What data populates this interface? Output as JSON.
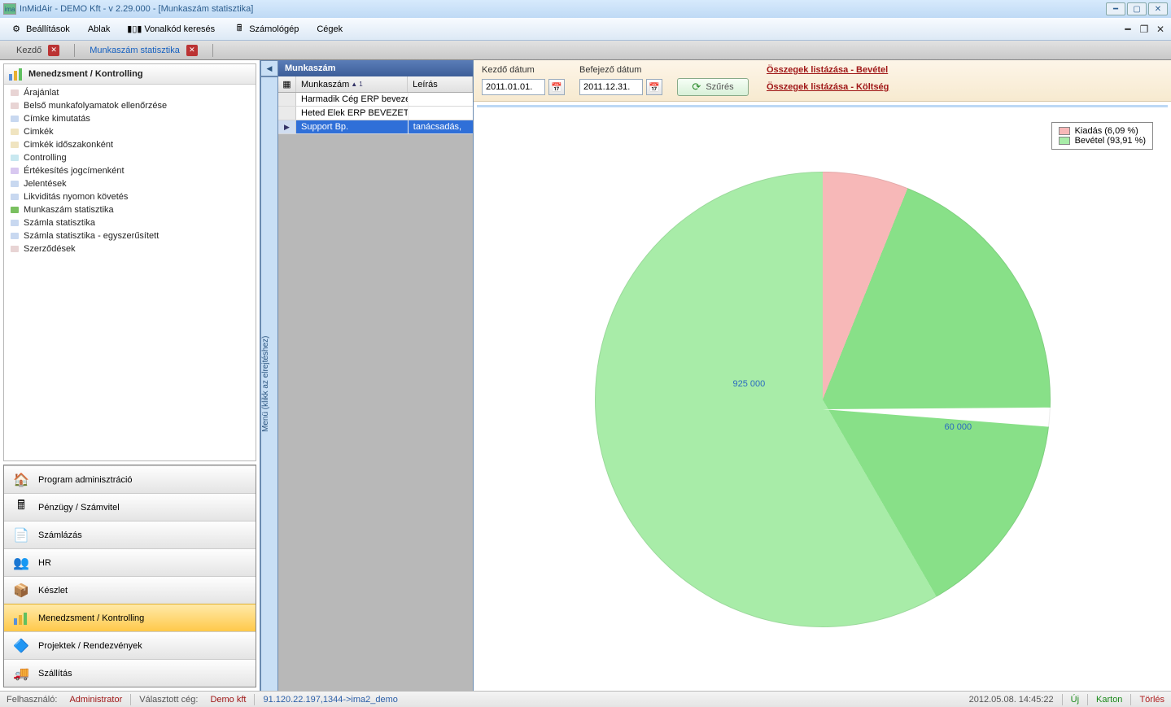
{
  "window": {
    "title": "InMidAir - DEMO Kft - v 2.29.000 - [Munkaszám statisztika]"
  },
  "menu": {
    "settings": "Beállítások",
    "window": "Ablak",
    "barcode_search": "Vonalkód keresés",
    "calculator": "Számológép",
    "companies": "Cégek"
  },
  "tabs": {
    "home": "Kezdő",
    "workno_stats": "Munkaszám statisztika"
  },
  "sidebar": {
    "header": "Menedzsment / Kontrolling",
    "items": [
      "Árajánlat",
      "Belső munkafolyamatok ellenőrzése",
      "Címke kimutatás",
      "Cimkék",
      "Cimkék időszakonként",
      "Controlling",
      "Értékesítés jogcímenként",
      "Jelentések",
      "Likviditás nyomon követés",
      "Munkaszám statisztika",
      "Számla statisztika",
      "Számla statisztika - egyszerűsített",
      "Szerződések"
    ],
    "bullet_colors": [
      "#e8d4d4",
      "#e8d4d4",
      "#c8d8f0",
      "#f0e4c0",
      "#f0e4c0",
      "#c8e8f0",
      "#d8c8f0",
      "#c8d8f0",
      "#c8d8f0",
      "#7ac060",
      "#c8d8f0",
      "#c8d8f0",
      "#e8d4d4"
    ],
    "collapse_hint": "Menü (klikk az elrejtéshez)"
  },
  "modules": {
    "program_admin": "Program adminisztráció",
    "finance": "Pénzügy / Számvitel",
    "billing": "Számlázás",
    "hr": "HR",
    "stock": "Készlet",
    "management": "Menedzsment / Kontrolling",
    "projects": "Projektek / Rendezvények",
    "shipping": "Szállítás"
  },
  "list": {
    "title": "Munkaszám",
    "col1": "Munkaszám",
    "col2": "Leírás",
    "sort_indicator": "1",
    "rows": [
      {
        "name": "Harmadik Cég ERP bevezetés",
        "desc": ""
      },
      {
        "name": "Heted Elek ERP BEVEZETÉS",
        "desc": ""
      },
      {
        "name": "Support Bp.",
        "desc": "tanácsadás,"
      }
    ],
    "selected_index": 2
  },
  "filter": {
    "start_label": "Kezdő dátum",
    "end_label": "Befejező dátum",
    "start_value": "2011.01.01.",
    "end_value": "2011.12.31.",
    "button": "Szűrés",
    "link_revenue": "Összegek listázása - Bevétel",
    "link_cost": "Összegek listázása - Költség"
  },
  "chart_data": {
    "type": "pie",
    "title": "",
    "series": [
      {
        "name": "Kiadás",
        "value": 60000,
        "pct": 6.09,
        "color": "#f7b8b8"
      },
      {
        "name": "Bevétel",
        "value": 925000,
        "pct": 93.91,
        "color": "#88e088"
      }
    ],
    "labels": {
      "big": "925 000",
      "small": "60 000"
    },
    "legend": {
      "kiadas": "Kiadás (6,09 %)",
      "bevetel": "Bevétel (93,91 %)"
    }
  },
  "status": {
    "user_label": "Felhasználó:",
    "user": "Administrator",
    "company_label": "Választott cég:",
    "company": "Demo kft",
    "conn": "91.120.22.197,1344->ima2_demo",
    "datetime": "2012.05.08. 14:45:22",
    "new": "Új",
    "card": "Karton",
    "delete": "Törlés"
  }
}
